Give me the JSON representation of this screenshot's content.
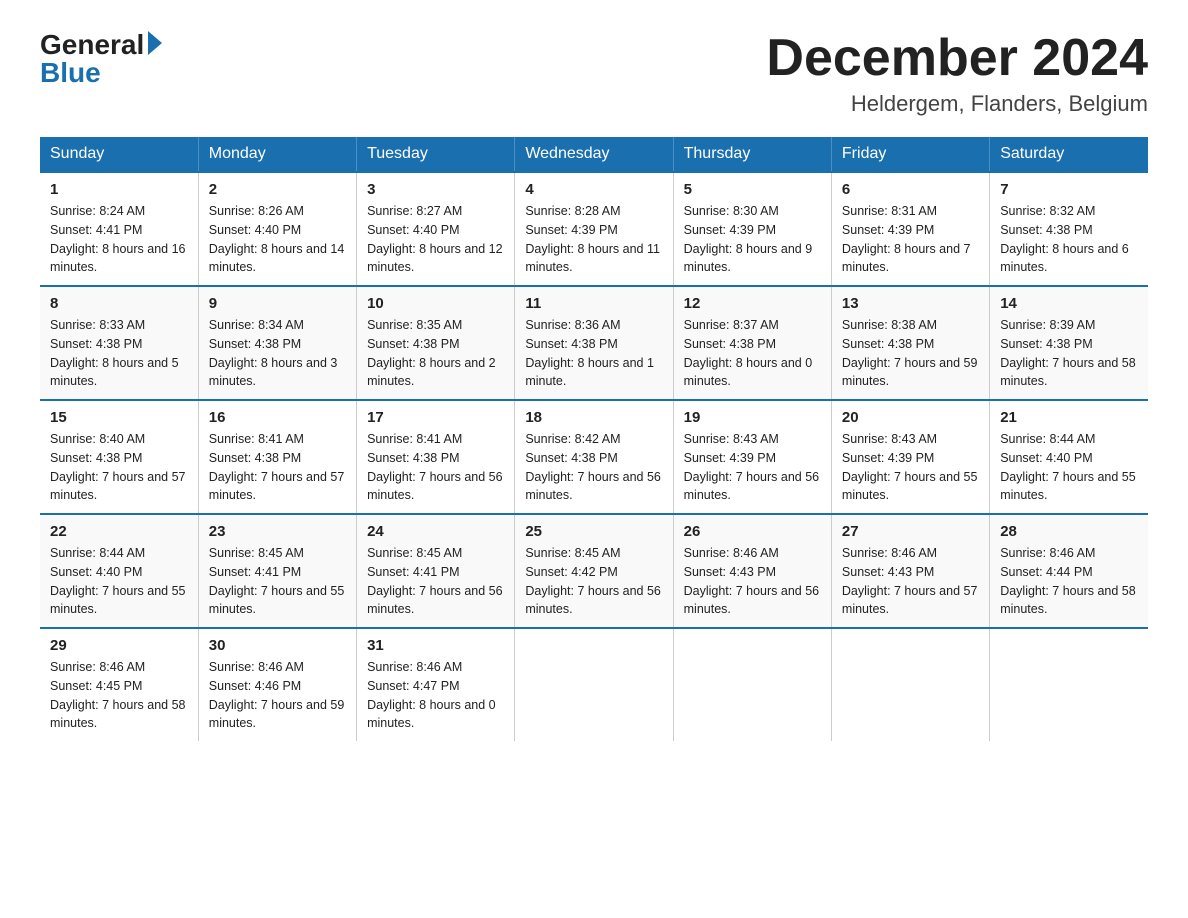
{
  "header": {
    "logo_line1": "General",
    "logo_line2": "Blue",
    "month_title": "December 2024",
    "location": "Heldergem, Flanders, Belgium"
  },
  "days_of_week": [
    "Sunday",
    "Monday",
    "Tuesday",
    "Wednesday",
    "Thursday",
    "Friday",
    "Saturday"
  ],
  "weeks": [
    [
      {
        "day": "1",
        "sunrise": "8:24 AM",
        "sunset": "4:41 PM",
        "daylight": "8 hours and 16 minutes."
      },
      {
        "day": "2",
        "sunrise": "8:26 AM",
        "sunset": "4:40 PM",
        "daylight": "8 hours and 14 minutes."
      },
      {
        "day": "3",
        "sunrise": "8:27 AM",
        "sunset": "4:40 PM",
        "daylight": "8 hours and 12 minutes."
      },
      {
        "day": "4",
        "sunrise": "8:28 AM",
        "sunset": "4:39 PM",
        "daylight": "8 hours and 11 minutes."
      },
      {
        "day": "5",
        "sunrise": "8:30 AM",
        "sunset": "4:39 PM",
        "daylight": "8 hours and 9 minutes."
      },
      {
        "day": "6",
        "sunrise": "8:31 AM",
        "sunset": "4:39 PM",
        "daylight": "8 hours and 7 minutes."
      },
      {
        "day": "7",
        "sunrise": "8:32 AM",
        "sunset": "4:38 PM",
        "daylight": "8 hours and 6 minutes."
      }
    ],
    [
      {
        "day": "8",
        "sunrise": "8:33 AM",
        "sunset": "4:38 PM",
        "daylight": "8 hours and 5 minutes."
      },
      {
        "day": "9",
        "sunrise": "8:34 AM",
        "sunset": "4:38 PM",
        "daylight": "8 hours and 3 minutes."
      },
      {
        "day": "10",
        "sunrise": "8:35 AM",
        "sunset": "4:38 PM",
        "daylight": "8 hours and 2 minutes."
      },
      {
        "day": "11",
        "sunrise": "8:36 AM",
        "sunset": "4:38 PM",
        "daylight": "8 hours and 1 minute."
      },
      {
        "day": "12",
        "sunrise": "8:37 AM",
        "sunset": "4:38 PM",
        "daylight": "8 hours and 0 minutes."
      },
      {
        "day": "13",
        "sunrise": "8:38 AM",
        "sunset": "4:38 PM",
        "daylight": "7 hours and 59 minutes."
      },
      {
        "day": "14",
        "sunrise": "8:39 AM",
        "sunset": "4:38 PM",
        "daylight": "7 hours and 58 minutes."
      }
    ],
    [
      {
        "day": "15",
        "sunrise": "8:40 AM",
        "sunset": "4:38 PM",
        "daylight": "7 hours and 57 minutes."
      },
      {
        "day": "16",
        "sunrise": "8:41 AM",
        "sunset": "4:38 PM",
        "daylight": "7 hours and 57 minutes."
      },
      {
        "day": "17",
        "sunrise": "8:41 AM",
        "sunset": "4:38 PM",
        "daylight": "7 hours and 56 minutes."
      },
      {
        "day": "18",
        "sunrise": "8:42 AM",
        "sunset": "4:38 PM",
        "daylight": "7 hours and 56 minutes."
      },
      {
        "day": "19",
        "sunrise": "8:43 AM",
        "sunset": "4:39 PM",
        "daylight": "7 hours and 56 minutes."
      },
      {
        "day": "20",
        "sunrise": "8:43 AM",
        "sunset": "4:39 PM",
        "daylight": "7 hours and 55 minutes."
      },
      {
        "day": "21",
        "sunrise": "8:44 AM",
        "sunset": "4:40 PM",
        "daylight": "7 hours and 55 minutes."
      }
    ],
    [
      {
        "day": "22",
        "sunrise": "8:44 AM",
        "sunset": "4:40 PM",
        "daylight": "7 hours and 55 minutes."
      },
      {
        "day": "23",
        "sunrise": "8:45 AM",
        "sunset": "4:41 PM",
        "daylight": "7 hours and 55 minutes."
      },
      {
        "day": "24",
        "sunrise": "8:45 AM",
        "sunset": "4:41 PM",
        "daylight": "7 hours and 56 minutes."
      },
      {
        "day": "25",
        "sunrise": "8:45 AM",
        "sunset": "4:42 PM",
        "daylight": "7 hours and 56 minutes."
      },
      {
        "day": "26",
        "sunrise": "8:46 AM",
        "sunset": "4:43 PM",
        "daylight": "7 hours and 56 minutes."
      },
      {
        "day": "27",
        "sunrise": "8:46 AM",
        "sunset": "4:43 PM",
        "daylight": "7 hours and 57 minutes."
      },
      {
        "day": "28",
        "sunrise": "8:46 AM",
        "sunset": "4:44 PM",
        "daylight": "7 hours and 58 minutes."
      }
    ],
    [
      {
        "day": "29",
        "sunrise": "8:46 AM",
        "sunset": "4:45 PM",
        "daylight": "7 hours and 58 minutes."
      },
      {
        "day": "30",
        "sunrise": "8:46 AM",
        "sunset": "4:46 PM",
        "daylight": "7 hours and 59 minutes."
      },
      {
        "day": "31",
        "sunrise": "8:46 AM",
        "sunset": "4:47 PM",
        "daylight": "8 hours and 0 minutes."
      },
      {
        "day": "",
        "sunrise": "",
        "sunset": "",
        "daylight": ""
      },
      {
        "day": "",
        "sunrise": "",
        "sunset": "",
        "daylight": ""
      },
      {
        "day": "",
        "sunrise": "",
        "sunset": "",
        "daylight": ""
      },
      {
        "day": "",
        "sunrise": "",
        "sunset": "",
        "daylight": ""
      }
    ]
  ],
  "labels": {
    "sunrise_prefix": "Sunrise: ",
    "sunset_prefix": "Sunset: ",
    "daylight_prefix": "Daylight: "
  }
}
